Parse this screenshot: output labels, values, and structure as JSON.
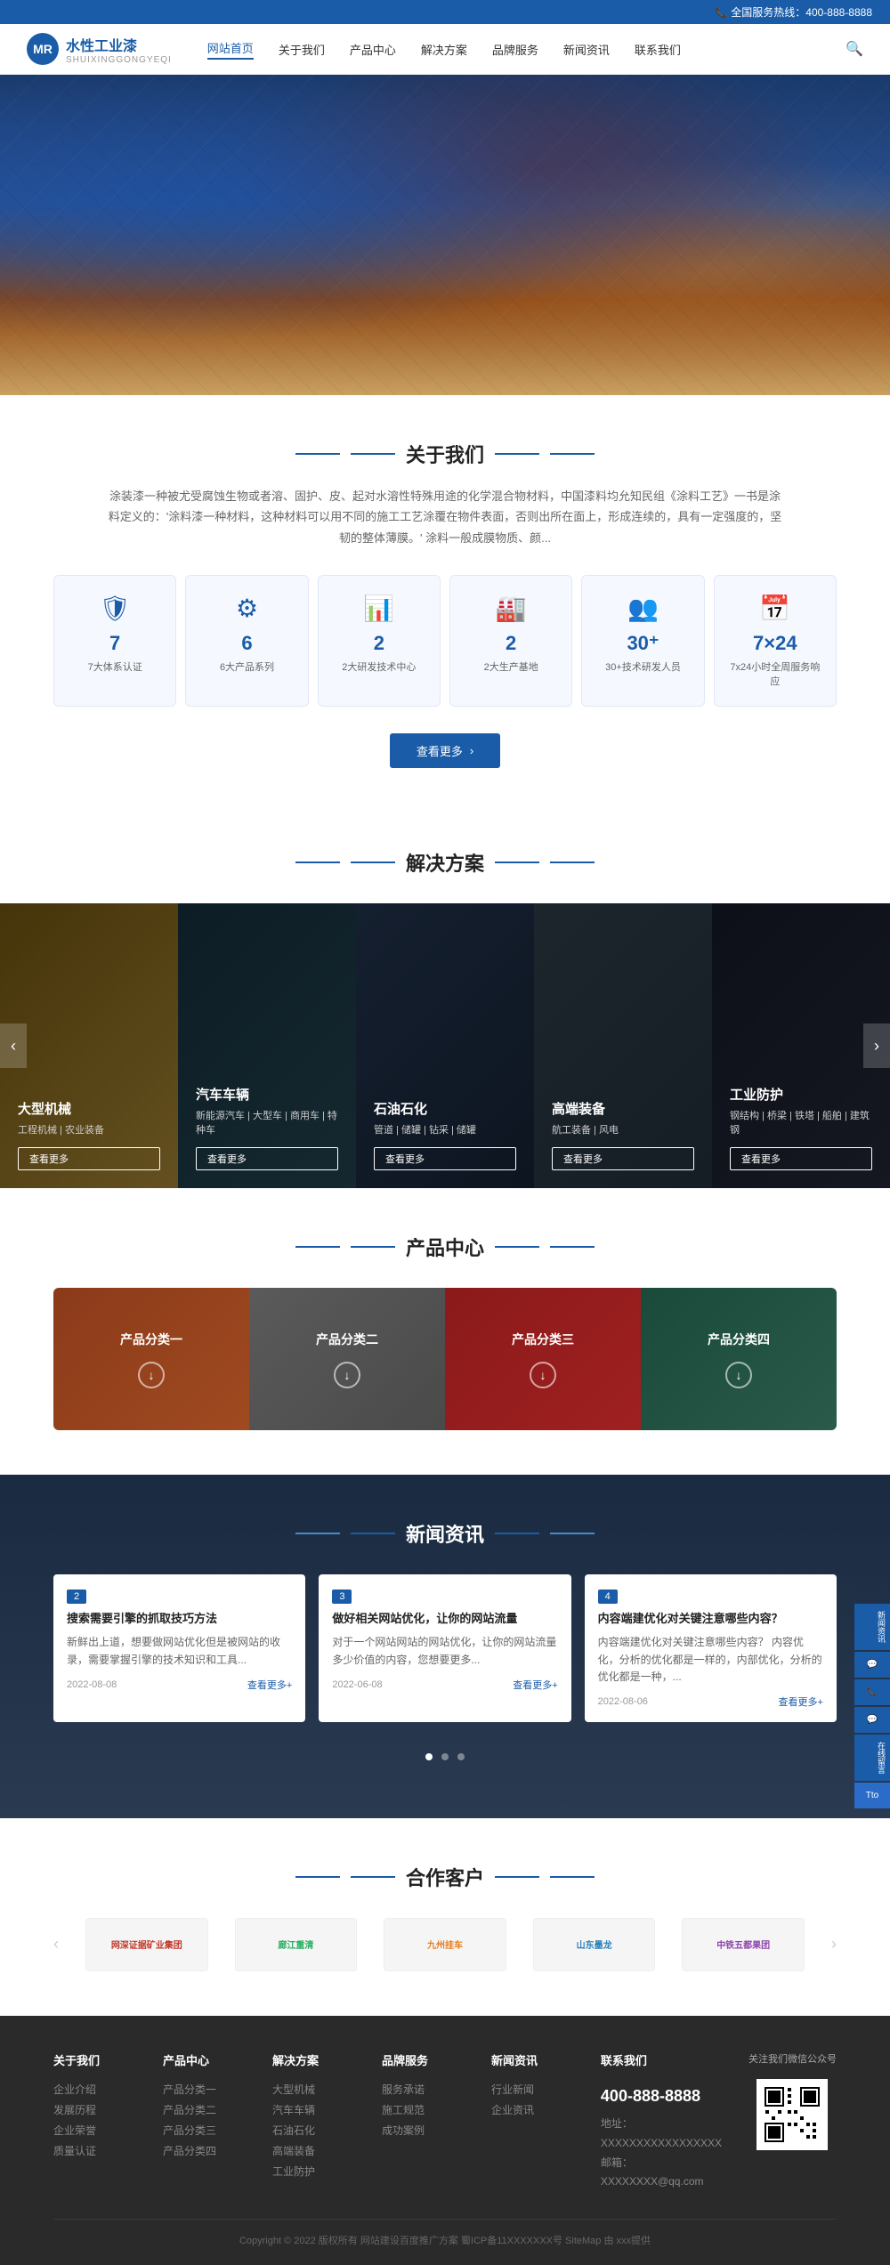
{
  "topbar": {
    "phone_label": "全国服务热线：400-888-8888",
    "phone_icon": "📞"
  },
  "header": {
    "logo_abbr": "MR",
    "logo_name": "水性工业漆",
    "logo_sub": "SHUIXINGGONGYEQI",
    "nav": [
      {
        "label": "网站首页",
        "active": true
      },
      {
        "label": "关于我们"
      },
      {
        "label": "产品中心"
      },
      {
        "label": "解决方案"
      },
      {
        "label": "品牌服务"
      },
      {
        "label": "新闻资讯"
      },
      {
        "label": "联系我们"
      }
    ]
  },
  "about": {
    "title": "关于我们",
    "text": "涂装漆一种被尤受腐蚀生物或者溶、固护、皮、起对水溶性特殊用途的化学混合物材料，中国漆料均允知民组《涂料工艺》一书是涂料定义的：'涂料漆一种材料，这种材料可以用不同的施工工艺涂覆在物件表面，否则出所在面上，形成连续的，具有一定强度的，坚韧的整体薄膜。' 涂料一般成膜物质、颜...",
    "stats": [
      {
        "number": "7",
        "label": "7大体系认证",
        "icon": "🛡"
      },
      {
        "number": "6",
        "label": "6大产品系列",
        "icon": "⚙"
      },
      {
        "number": "2",
        "label": "2大研发技术中心",
        "icon": "📊"
      },
      {
        "number": "2",
        "label": "2大生产基地",
        "icon": "🏭"
      },
      {
        "number": "30⁺",
        "label": "30+技术研发人员",
        "icon": "👥"
      },
      {
        "number": "7×24",
        "label": "7x24小时全周服务响应",
        "icon": "📅"
      }
    ],
    "more_btn": "查看更多"
  },
  "solutions": {
    "title": "解决方案",
    "cards": [
      {
        "title": "大型机械",
        "sub": "工程机械 | 农业装备",
        "btn": "查看更多"
      },
      {
        "title": "汽车车辆",
        "sub": "新能源汽车 | 大型车 | 商用车 | 特种车",
        "btn": "查看更多"
      },
      {
        "title": "石油石化",
        "sub": "管道 | 储罐 | 钻采 | 储罐",
        "btn": "查看更多"
      },
      {
        "title": "高端装备",
        "sub": "航工装备 | 风电",
        "btn": "查看更多"
      },
      {
        "title": "工业防护",
        "sub": "钢结构 | 桥梁 | 铁塔 | 船舶 | 建筑钢",
        "btn": "查看更多"
      }
    ]
  },
  "products": {
    "title": "产品中心",
    "categories": [
      {
        "label": "产品分类一"
      },
      {
        "label": "产品分类二"
      },
      {
        "label": "产品分类三"
      },
      {
        "label": "产品分类四"
      }
    ]
  },
  "news": {
    "title": "新闻资讯",
    "cards": [
      {
        "tag": "2",
        "title": "搜索需要引擎的抓取技巧方法",
        "text": "新鲜出上道，想要做网站优化但是被网站的收录，需要掌握引擎的技术知识和工具...",
        "date": "2022-08-08",
        "more": "查看更多+"
      },
      {
        "tag": "3",
        "title": "做好相关网站优化，让你的网站流量",
        "text": "对于一个网站网站的网站优化，让你的网站流量多少价值的内容，您想要更多...",
        "date": "2022-06-08",
        "more": "查看更多+"
      },
      {
        "tag": "4",
        "title": "内容端建优化对关键注意哪些内容？",
        "text": "内容端建优化对关键注意哪些内容？ 内容优化，分析的优化都是一样的，内部优化，分析的优化都是一种，...",
        "date": "2022-08-06",
        "more": "查看更多+"
      }
    ]
  },
  "partners": {
    "title": "合作客户",
    "logos": [
      {
        "name": "网深证据矿业集团",
        "color": "#c0392b"
      },
      {
        "name": "廊江重清",
        "color": "#27ae60"
      },
      {
        "name": "九州挂车",
        "color": "#e67e22"
      },
      {
        "name": "山东墨龙",
        "color": "#2980b9"
      },
      {
        "name": "中铁五都果团",
        "color": "#8e44ad"
      }
    ]
  },
  "footer": {
    "cols": [
      {
        "title": "关于我们",
        "links": [
          "企业介绍",
          "发展历程",
          "企业荣誉",
          "质量认证"
        ]
      },
      {
        "title": "产品中心",
        "links": [
          "产品分类一",
          "产品分类二",
          "产品分类三",
          "产品分类四"
        ]
      },
      {
        "title": "解决方案",
        "links": [
          "大型机械",
          "汽车车辆",
          "石油石化",
          "高端装备",
          "工业防护"
        ]
      },
      {
        "title": "品牌服务",
        "links": [
          "服务承诺",
          "施工规范",
          "成功案例"
        ]
      },
      {
        "title": "新闻资讯",
        "links": [
          "行业新闻",
          "企业资讯"
        ]
      },
      {
        "title": "联系我们",
        "phone": "400-888-8888",
        "address": "地址：XXXXXXXXXXXXXXXXX",
        "email": "邮箱：XXXXXXXX@qq.com",
        "qr_label": "关注我们微信公众号"
      }
    ],
    "copyright": "Copyright © 2022 版权所有 网站建设百度推广方案 蜀ICP备11XXXXXXX号 SiteMap 由 xxx提供"
  },
  "float": {
    "buttons": [
      "新闻资讯",
      "微信",
      "电话",
      "QQ",
      "在线留言"
    ],
    "top_label": "Tto"
  }
}
